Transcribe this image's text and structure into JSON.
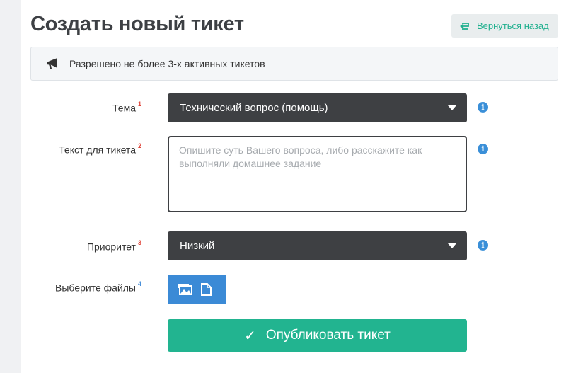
{
  "header": {
    "title": "Создать новый тикет",
    "back_label": "Вернуться назад",
    "back_icon": "return-arrow-icon"
  },
  "notice": {
    "icon": "megaphone-icon",
    "text": "Разрешено не более 3-х активных тикетов"
  },
  "form": {
    "topic": {
      "label": "Тема",
      "marker": "1",
      "selected": "Технический вопрос (помощь)"
    },
    "message": {
      "label": "Текст для тикета",
      "marker": "2",
      "placeholder": "Опишите суть Вашего вопроса, либо расскажите как выполняли домашнее задание",
      "value": ""
    },
    "priority": {
      "label": "Приоритет",
      "marker": "3",
      "selected": "Низкий"
    },
    "files": {
      "label": "Выберите файлы",
      "marker": "4",
      "icons": [
        "image-upload-icon",
        "document-icon"
      ]
    },
    "submit": {
      "check": "✓",
      "label": "Опубликовать тикет"
    }
  },
  "colors": {
    "accent_green": "#22b490",
    "select_bg": "#3e4043",
    "file_button_blue": "#3b8ad6",
    "info_icon_blue": "#3a8fd8",
    "marker_red": "#e0453a",
    "marker_blue": "#4a90d9"
  }
}
